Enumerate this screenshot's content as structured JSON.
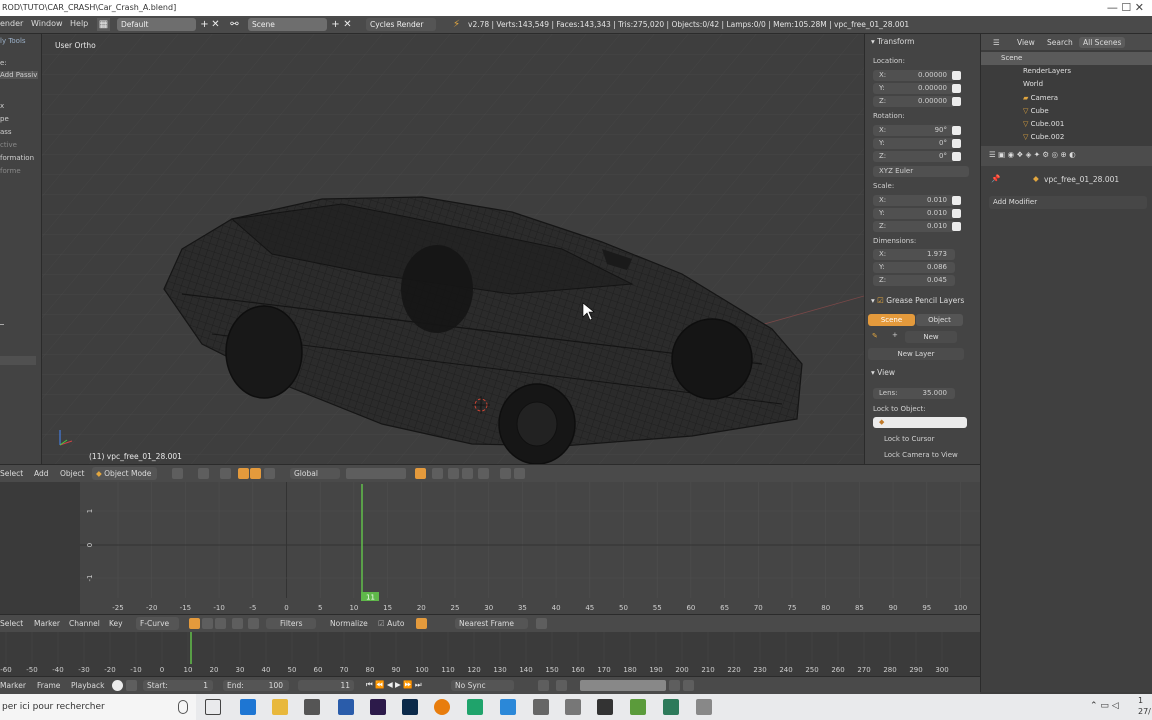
{
  "titlebar": {
    "path": "ROD\\TUTO\\CAR_CRASH\\Car_Crash_A.blend]",
    "window_controls": "— ☐ ✕"
  },
  "infobar": {
    "menus": [
      "ender",
      "Window",
      "Help"
    ],
    "screen_layout": "Default",
    "scene": "Scene",
    "engine": "Cycles Render",
    "stats": "v2.78 | Verts:143,549 | Faces:143,343 | Tris:275,020 | Objects:0/42 | Lamps:0/0 | Mem:105.28M | vpc_free_01_28.001"
  },
  "toolstrip": {
    "title": "ly Tools",
    "items": [
      "e:",
      "Add Passiv",
      "x",
      "pe",
      "ass",
      "ctive",
      "formation",
      "forme"
    ]
  },
  "viewport": {
    "view_name": "User Ortho",
    "active_object": "(11) vpc_free_01_28.001"
  },
  "npanel": {
    "transform_title": "Transform",
    "location_label": "Location:",
    "location": [
      {
        "k": "X:",
        "v": "0.00000"
      },
      {
        "k": "Y:",
        "v": "0.00000"
      },
      {
        "k": "Z:",
        "v": "0.00000"
      }
    ],
    "rotation_label": "Rotation:",
    "rotation": [
      {
        "k": "X:",
        "v": "90°"
      },
      {
        "k": "Y:",
        "v": "0°"
      },
      {
        "k": "Z:",
        "v": "0°"
      }
    ],
    "rotation_mode": "XYZ Euler",
    "scale_label": "Scale:",
    "scale": [
      {
        "k": "X:",
        "v": "0.010"
      },
      {
        "k": "Y:",
        "v": "0.010"
      },
      {
        "k": "Z:",
        "v": "0.010"
      }
    ],
    "dimensions_label": "Dimensions:",
    "dimensions": [
      {
        "k": "X:",
        "v": "1.973"
      },
      {
        "k": "Y:",
        "v": "0.086"
      },
      {
        "k": "Z:",
        "v": "0.045"
      }
    ],
    "grease_title": "Grease Pencil Layers",
    "grease_scene": "Scene",
    "grease_object": "Object",
    "grease_new": "New",
    "grease_new_layer": "New Layer",
    "view_title": "View",
    "lens_label": "Lens:",
    "lens_value": "35.000",
    "lock_object_label": "Lock to Object:",
    "lock_cursor": "Lock to Cursor",
    "lock_camera": "Lock Camera to View"
  },
  "outliner": {
    "menu_view": "View",
    "menu_search": "Search",
    "scope": "All Scenes",
    "rows": [
      "Scene",
      "RenderLayers",
      "World",
      "Camera",
      "Cube",
      "Cube.001",
      "Cube.002"
    ]
  },
  "properties": {
    "object_name": "vpc_free_01_28.001",
    "add_modifier": "Add Modifier"
  },
  "vpheader": {
    "select": "Select",
    "add": "Add",
    "object": "Object",
    "mode": "Object Mode",
    "orientation": "Global"
  },
  "graph": {
    "frame_marker": "11",
    "y_ticks": [
      "1",
      "0",
      "-1"
    ],
    "x_ticks": [
      "-25",
      "-20",
      "-15",
      "-10",
      "-5",
      "0",
      "5",
      "10",
      "15",
      "20",
      "25",
      "30",
      "35",
      "40",
      "45",
      "50",
      "55",
      "60",
      "65",
      "70",
      "75",
      "80",
      "85",
      "90",
      "95",
      "100"
    ],
    "colors": {
      "playhead": "#5fb84a",
      "background": "#454545"
    }
  },
  "graphhdr": {
    "select": "Select",
    "marker": "Marker",
    "channel": "Channel",
    "key": "Key",
    "editor": "F-Curve",
    "filters": "Filters",
    "normalize": "Normalize",
    "auto": "Auto",
    "snap": "Nearest Frame"
  },
  "timeline": {
    "ticks": [
      "-60",
      "-50",
      "-40",
      "-30",
      "-20",
      "-10",
      "0",
      "10",
      "20",
      "30",
      "40",
      "50",
      "60",
      "70",
      "80",
      "90",
      "100",
      "110",
      "120",
      "130",
      "140",
      "150",
      "160",
      "170",
      "180",
      "190",
      "200",
      "210",
      "220",
      "230",
      "240",
      "250",
      "260",
      "270",
      "280",
      "290",
      "300"
    ]
  },
  "timelinehdr": {
    "marker": "Marker",
    "frame": "Frame",
    "playback": "Playback",
    "start_label": "Start:",
    "start_value": "1",
    "end_label": "End:",
    "end_value": "100",
    "current": "11",
    "sync": "No Sync"
  },
  "taskbar": {
    "search_text": "per ici pour rechercher",
    "clock": "1\n27/"
  }
}
